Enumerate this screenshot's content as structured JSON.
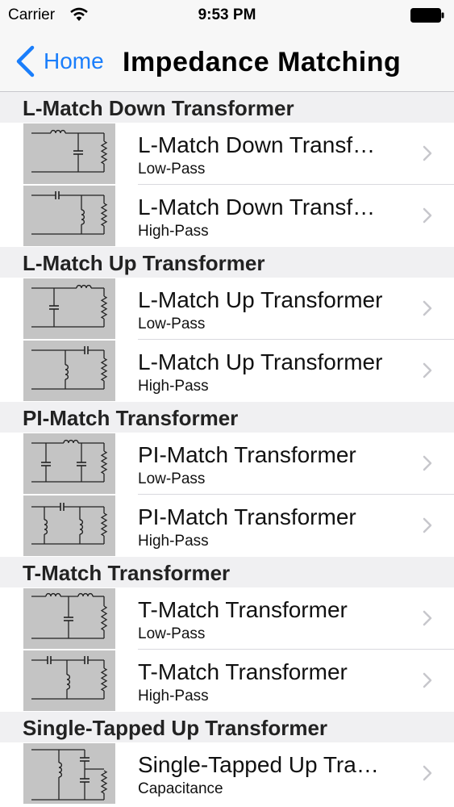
{
  "status_bar": {
    "carrier": "Carrier",
    "time": "9:53 PM"
  },
  "nav": {
    "back_label": "Home",
    "title": "Impedance Matching"
  },
  "sections": [
    {
      "header": "L-Match Down Transformer",
      "rows": [
        {
          "title": "L-Match Down Transf…",
          "subtitle": "Low-Pass",
          "diagram": "lmatch-down-lowpass-icon"
        },
        {
          "title": "L-Match Down Transf…",
          "subtitle": "High-Pass",
          "diagram": "lmatch-down-highpass-icon"
        }
      ]
    },
    {
      "header": "L-Match Up Transformer",
      "rows": [
        {
          "title": "L-Match Up Transformer",
          "subtitle": "Low-Pass",
          "diagram": "lmatch-up-lowpass-icon"
        },
        {
          "title": "L-Match Up Transformer",
          "subtitle": "High-Pass",
          "diagram": "lmatch-up-highpass-icon"
        }
      ]
    },
    {
      "header": "PI-Match Transformer",
      "rows": [
        {
          "title": "PI-Match Transformer",
          "subtitle": "Low-Pass",
          "diagram": "pimatch-lowpass-icon"
        },
        {
          "title": "PI-Match Transformer",
          "subtitle": "High-Pass",
          "diagram": "pimatch-highpass-icon"
        }
      ]
    },
    {
      "header": "T-Match Transformer",
      "rows": [
        {
          "title": "T-Match Transformer",
          "subtitle": "Low-Pass",
          "diagram": "tmatch-lowpass-icon"
        },
        {
          "title": "T-Match Transformer",
          "subtitle": "High-Pass",
          "diagram": "tmatch-highpass-icon"
        }
      ]
    },
    {
      "header": "Single-Tapped Up Transformer",
      "rows": [
        {
          "title": "Single-Tapped Up Tra…",
          "subtitle": "Capacitance",
          "diagram": "single-tapped-up-icon"
        }
      ]
    }
  ]
}
